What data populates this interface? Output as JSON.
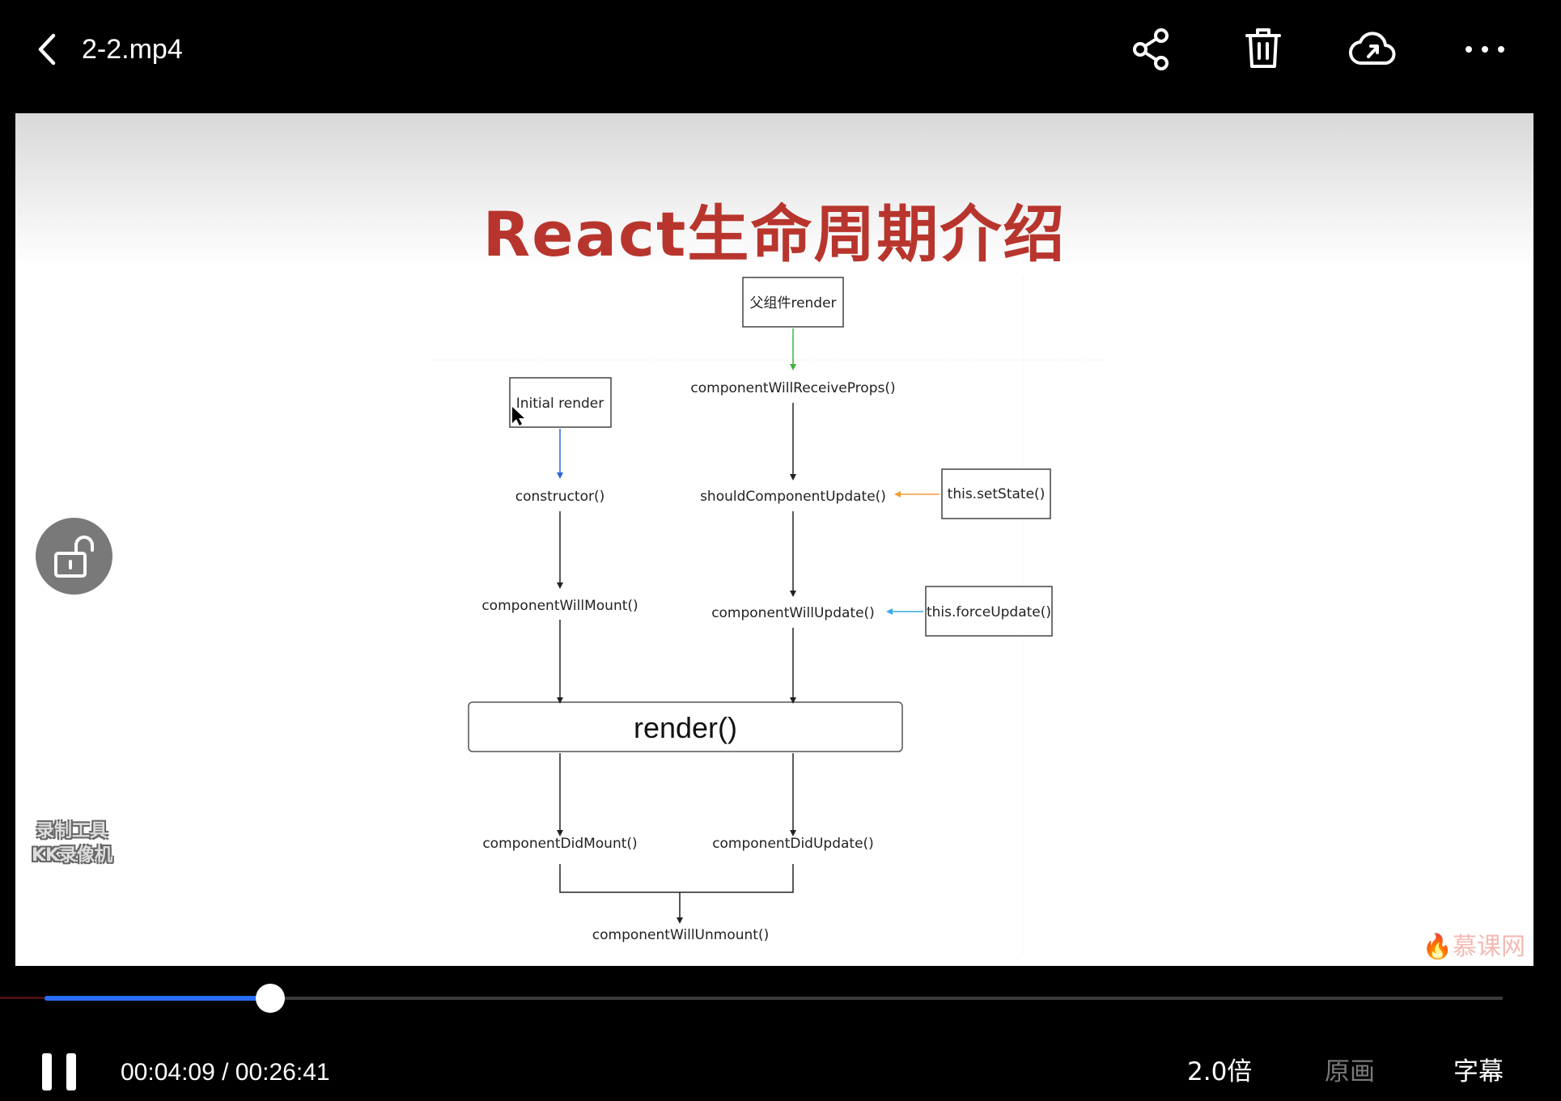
{
  "header": {
    "back_icon": "chevron-left-icon",
    "title": "2-2.mp4",
    "actions": [
      "share-icon",
      "trash-icon",
      "cloud-upload-icon",
      "more-icon"
    ]
  },
  "slide": {
    "title": "React生命周期介绍",
    "nodes": {
      "parent_render": "父组件render",
      "initial_render": "Initial render",
      "will_receive_props": "componentWillReceiveProps()",
      "constructor": "constructor()",
      "should_update": "shouldComponentUpdate()",
      "set_state": "this.setState()",
      "will_mount": "componentWillMount()",
      "will_update": "componentWillUpdate()",
      "force_update": "this.forceUpdate()",
      "render": "render()",
      "did_mount": "componentDidMount()",
      "did_update": "componentDidUpdate()",
      "will_unmount": "componentWillUnmount()"
    },
    "colors": {
      "title": "#b8352d",
      "parent_render": "#3cb43c",
      "initial_render": "#2f66d6",
      "set_state": "#f0a030",
      "force_update": "#3aa8e6"
    },
    "watermark_left": [
      "录制工具",
      "KK录像机"
    ],
    "watermark_right": "慕课网"
  },
  "lock_icon": "unlock-icon",
  "player": {
    "progress_fraction": 0.155,
    "current_time": "00:04:09",
    "total_time": "00:26:41",
    "time_separator": " / ",
    "pause_icon": "pause-icon",
    "speed": "2.0倍",
    "quality": "原画",
    "subtitles": "字幕"
  }
}
